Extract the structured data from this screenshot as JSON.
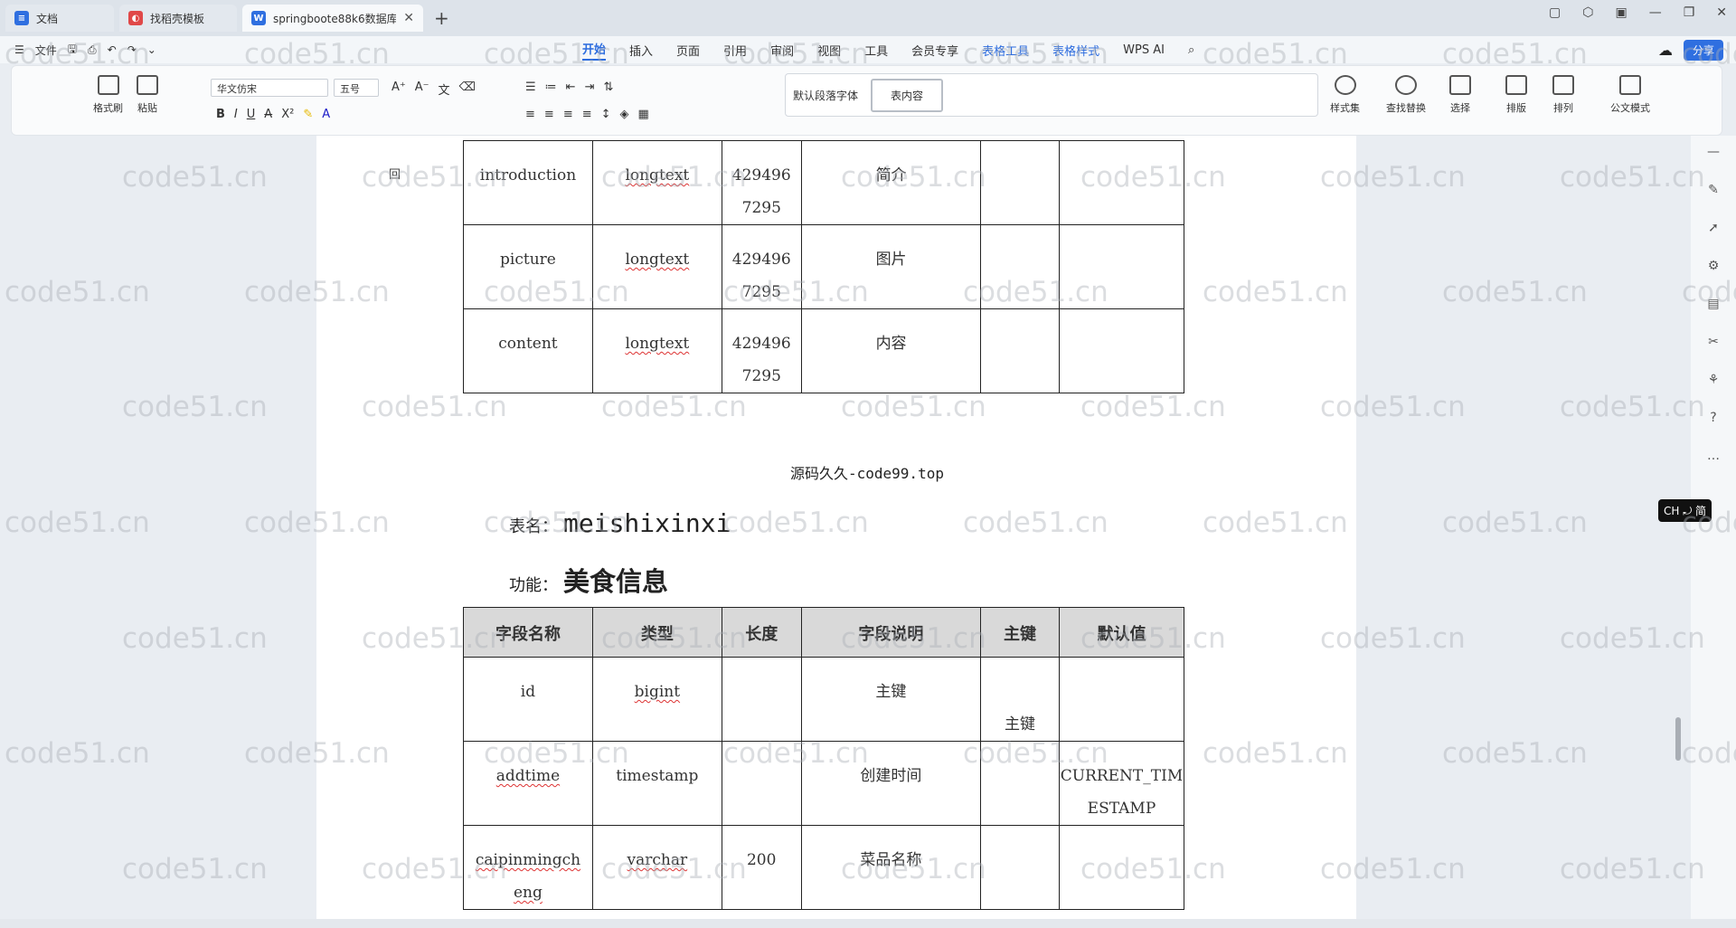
{
  "tabs": [
    {
      "label": "文档",
      "icon": "docs-icon",
      "color": "#2f6fe0"
    },
    {
      "label": "找稻壳模板",
      "icon": "docer-icon",
      "color": "#e04848"
    },
    {
      "label": "springboote88k6数据库文档",
      "icon": "word-icon",
      "color": "#2f6fe0"
    }
  ],
  "menu": {
    "file_label": "文件",
    "tabs": [
      "开始",
      "插入",
      "页面",
      "引用",
      "审阅",
      "视图",
      "工具",
      "会员专享",
      "表格工具",
      "表格样式"
    ],
    "active_tab": "开始",
    "wps_ai": "WPS AI",
    "share": "分享"
  },
  "ribbon": {
    "format_painter": "格式刷",
    "paste": "粘贴",
    "font_name": "华文仿宋",
    "font_size": "五号",
    "style_default": "默认段落字体",
    "style_table": "表内容",
    "style_set": "样式集",
    "find_replace": "查找替换",
    "select": "选择",
    "layout": "排版",
    "arrange": "排列",
    "official": "公文模式"
  },
  "doc": {
    "table1": [
      [
        "introduction",
        "longtext",
        "429496\n7295",
        "简介",
        "",
        ""
      ],
      [
        "picture",
        "longtext",
        "429496\n7295",
        "图片",
        "",
        ""
      ],
      [
        "content",
        "longtext",
        "429496\n7295",
        "内容",
        "",
        ""
      ]
    ],
    "center_text": "源码久久-code99.top",
    "table_name_label": "表名：",
    "table_name_value": "meishixinxi",
    "function_label": "功能：",
    "function_value": "美食信息",
    "table2_headers": [
      "字段名称",
      "类型",
      "长度",
      "字段说明",
      "主键",
      "默认值"
    ],
    "table2": [
      [
        "id",
        "bigint",
        "",
        "主键",
        "主键",
        ""
      ],
      [
        "addtime",
        "timestamp",
        "",
        "创建时间",
        "",
        "CURRENT_TIM\nESTAMP"
      ],
      [
        "caipinmingch\neng",
        "varchar",
        "200",
        "菜品名称",
        "",
        ""
      ]
    ],
    "marker": "回"
  },
  "ime_badge": "CH ⤾ 简",
  "watermark": "code51.cn"
}
